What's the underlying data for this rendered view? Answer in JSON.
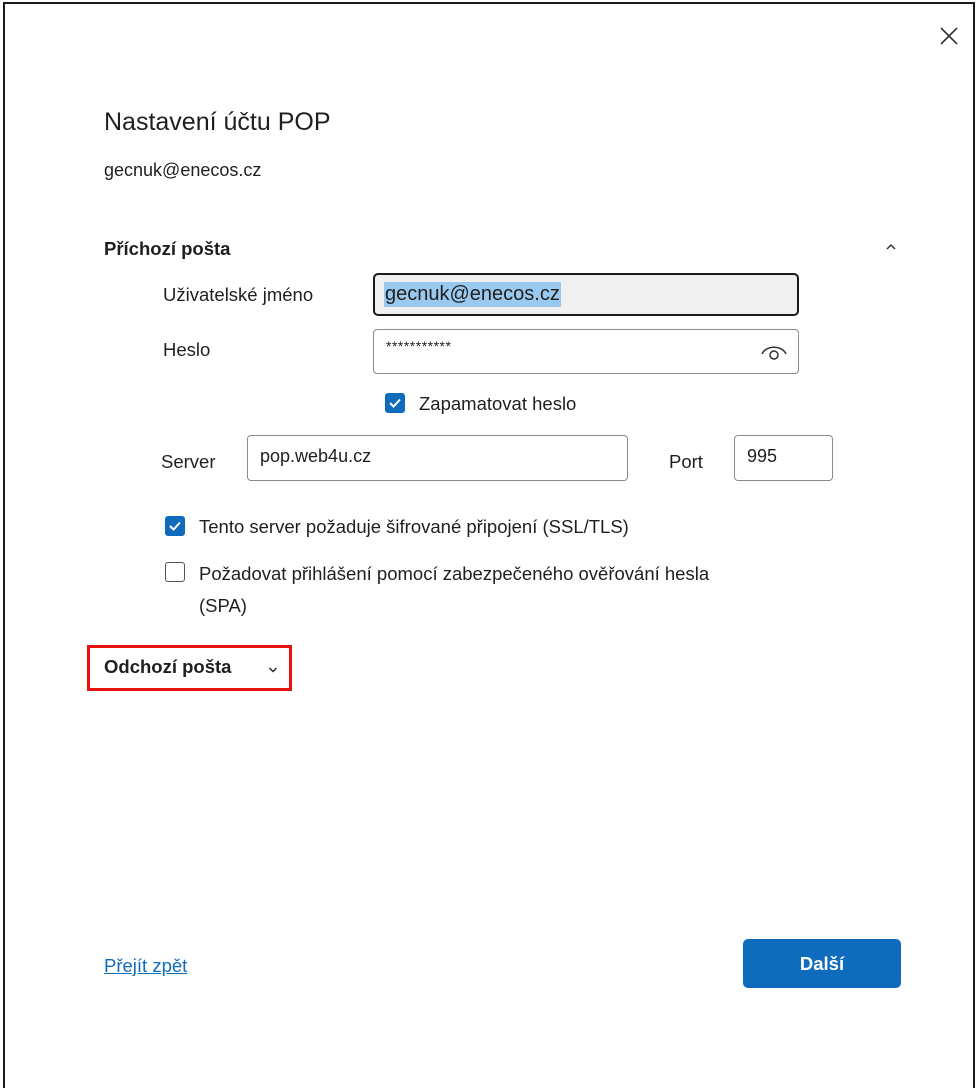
{
  "dialog": {
    "title": "Nastavení účtu POP",
    "email": "gecnuk@enecos.cz"
  },
  "incoming": {
    "heading": "Příchozí pošta",
    "username_label": "Uživatelské jméno",
    "username_value": "gecnuk@enecos.cz",
    "password_label": "Heslo",
    "password_value": "***********",
    "remember_label": "Zapamatovat heslo",
    "remember_checked": true,
    "server_label": "Server",
    "server_value": "pop.web4u.cz",
    "port_label": "Port",
    "port_value": "995",
    "ssl_label": "Tento server požaduje šifrované připojení (SSL/TLS)",
    "ssl_checked": true,
    "spa_label_line1": "Požadovat přihlášení pomocí zabezpečeného ověřování hesla",
    "spa_label_line2": "(SPA)",
    "spa_checked": false
  },
  "outgoing": {
    "heading": "Odchozí pošta"
  },
  "footer": {
    "back_label": "Přejít zpět",
    "next_label": "Další"
  },
  "colors": {
    "accent": "#0f6cbd",
    "highlight_border": "#e8120c",
    "selection": "#99c9ef"
  },
  "icons": [
    "close-icon",
    "chevron-up-icon",
    "eye-icon",
    "checkmark-icon",
    "chevron-down-icon"
  ]
}
